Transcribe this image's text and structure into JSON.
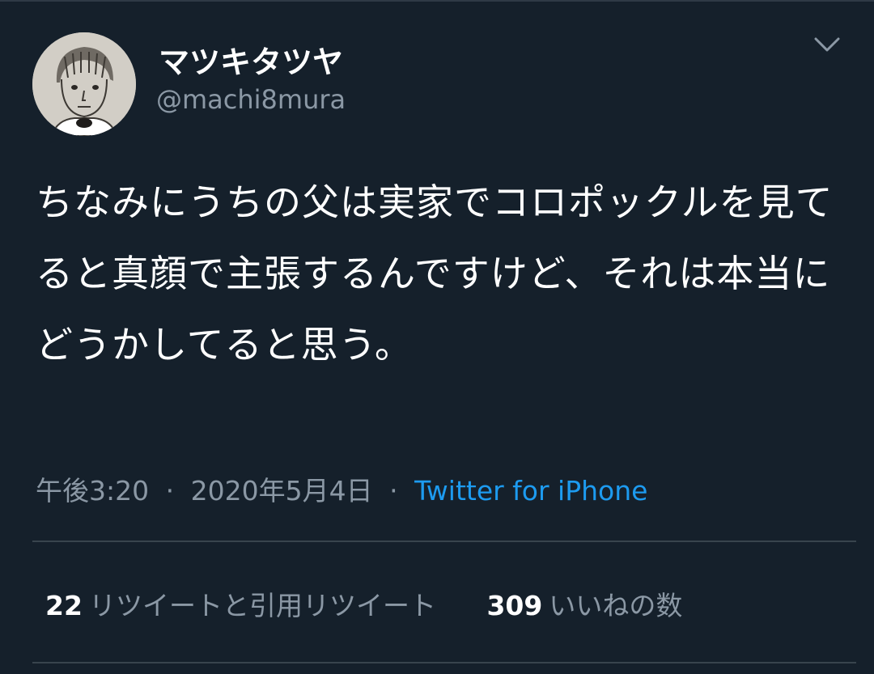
{
  "tweet": {
    "author": {
      "display_name": "マツキタツヤ",
      "handle": "@machi8mura"
    },
    "text": "ちなみにうちの父は実家でコロポックルを見てると真顔で主張するんですけど、それは本当にどうかしてると思う。",
    "timestamp": "午後3:20",
    "separator": "·",
    "date": "2020年5月4日",
    "source": "Twitter for iPhone",
    "stats": {
      "retweets_count": "22",
      "retweets_label": "リツイートと引用リツイート",
      "likes_count": "309",
      "likes_label": "いいねの数"
    }
  },
  "icons": {
    "menu": "chevron-down-icon",
    "avatar": "drawn-face-avatar"
  },
  "colors": {
    "background": "#15202b",
    "text_primary": "#ffffff",
    "text_secondary": "#8b98a5",
    "link": "#1d9bf0",
    "divider": "#38444d"
  }
}
